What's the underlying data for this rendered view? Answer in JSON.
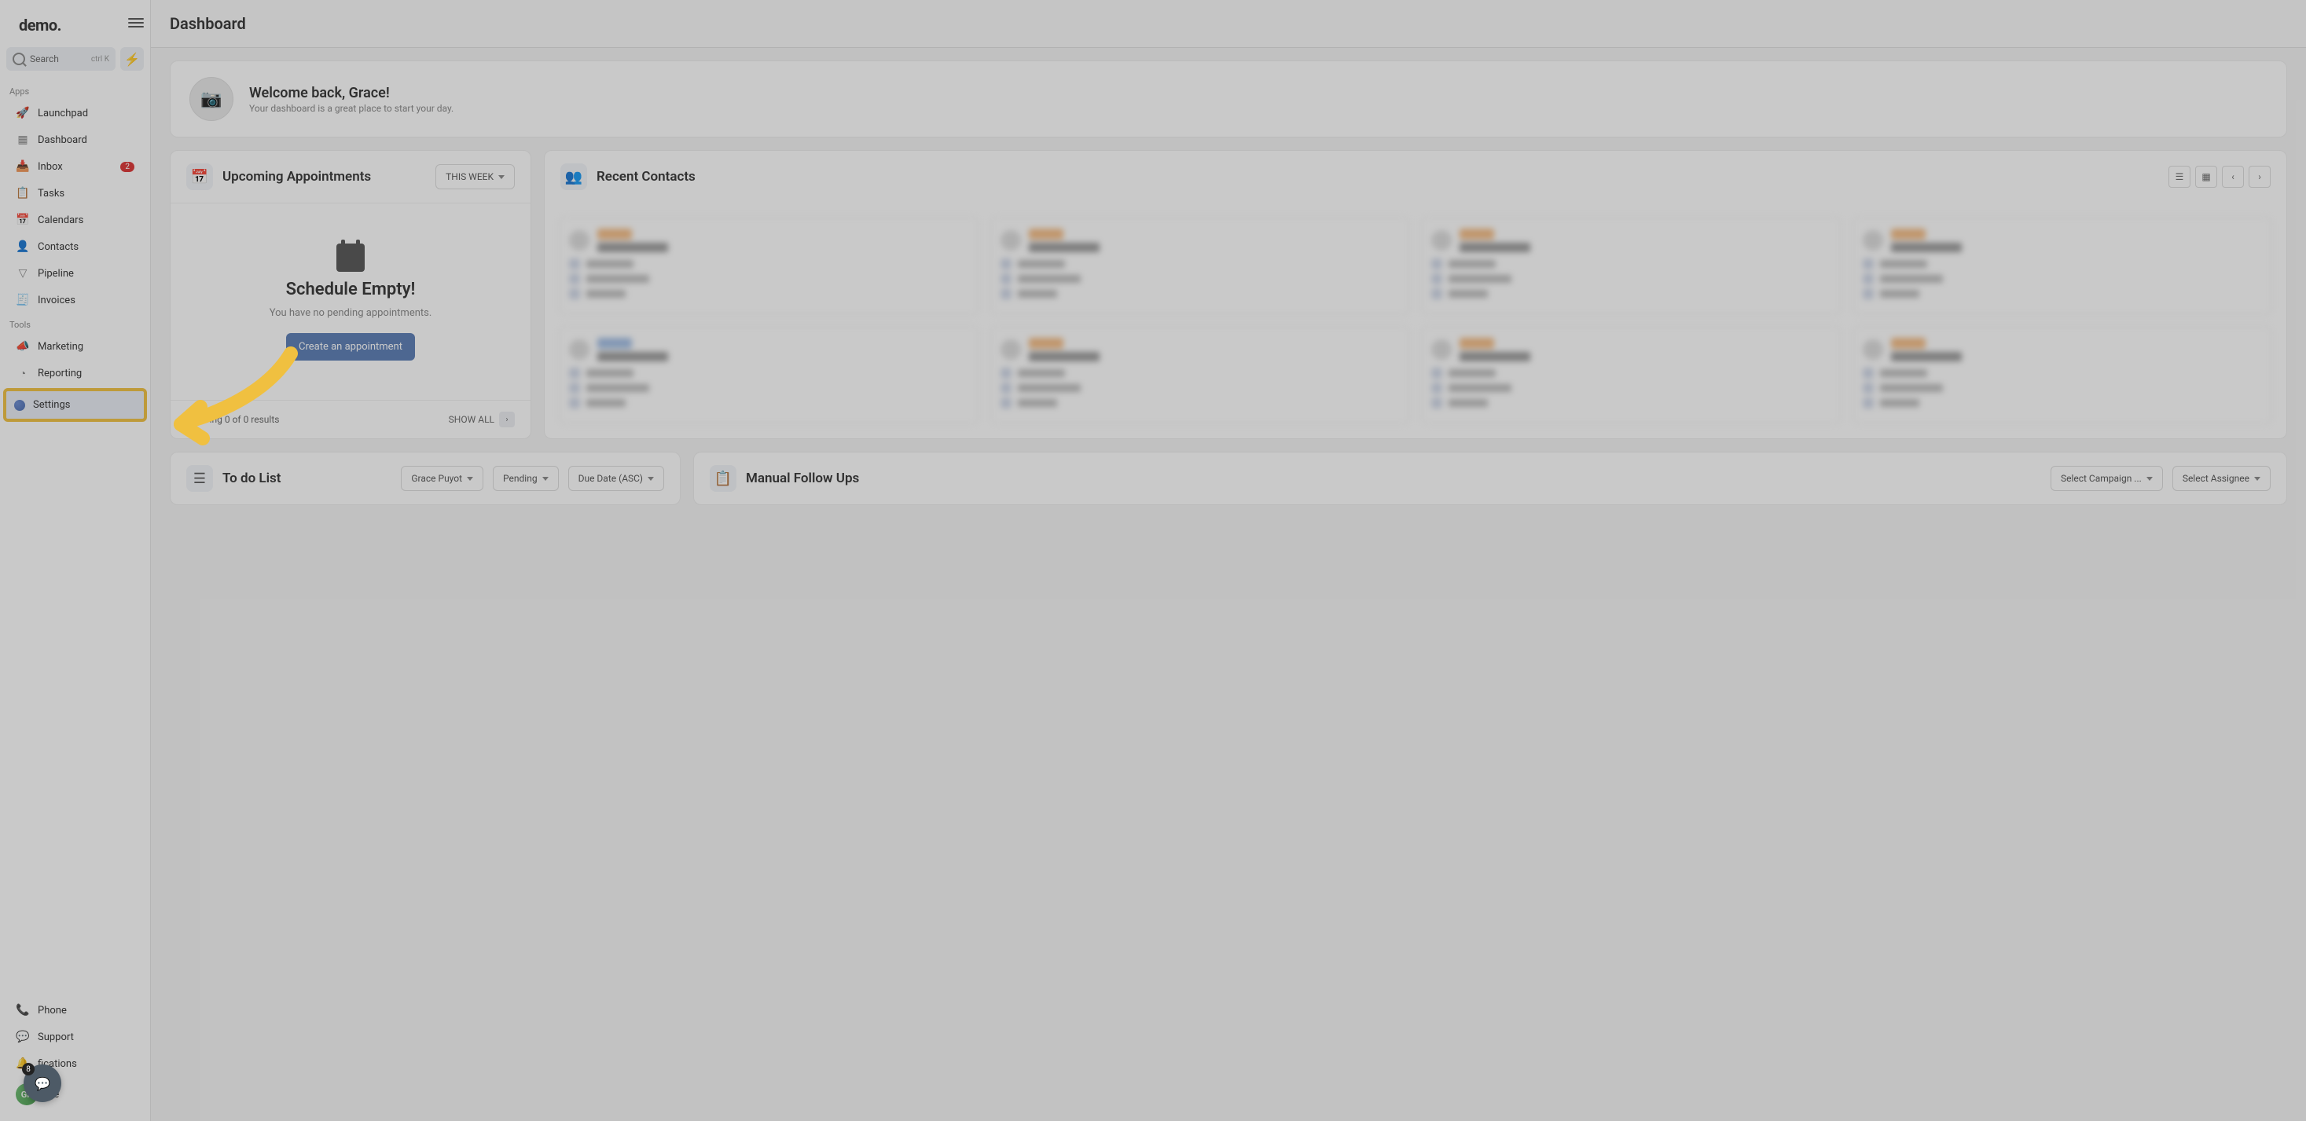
{
  "logo": "demo.",
  "search": {
    "placeholder": "Search",
    "shortcut": "ctrl K"
  },
  "sidebar": {
    "section_apps": "Apps",
    "section_tools": "Tools",
    "items": {
      "launchpad": "Launchpad",
      "dashboard": "Dashboard",
      "inbox": "Inbox",
      "inbox_badge": "2",
      "tasks": "Tasks",
      "calendars": "Calendars",
      "contacts": "Contacts",
      "pipeline": "Pipeline",
      "invoices": "Invoices",
      "marketing": "Marketing",
      "reporting": "Reporting",
      "settings": "Settings",
      "phone": "Phone",
      "support": "Support",
      "notifications": "fications",
      "profile": "file"
    },
    "avatar_initials": "GP"
  },
  "topbar": {
    "title": "Dashboard"
  },
  "welcome": {
    "title": "Welcome back, Grace!",
    "subtitle": "Your dashboard is a great place to start your day."
  },
  "appointments": {
    "title": "Upcoming Appointments",
    "filter": "THIS WEEK",
    "empty_title": "Schedule Empty!",
    "empty_sub": "You have no pending appointments.",
    "cta": "Create an appointment",
    "footer_count": "Showing 0 of 0 results",
    "show_all": "SHOW ALL"
  },
  "contacts": {
    "title": "Recent Contacts"
  },
  "todo": {
    "title": "To do List",
    "filter_user": "Grace Puyot",
    "filter_status": "Pending",
    "filter_sort": "Due Date (ASC)"
  },
  "followups": {
    "title": "Manual Follow Ups",
    "select_campaign": "Select Campaign ...",
    "select_assignee": "Select Assignee"
  },
  "chat_badge": "8"
}
